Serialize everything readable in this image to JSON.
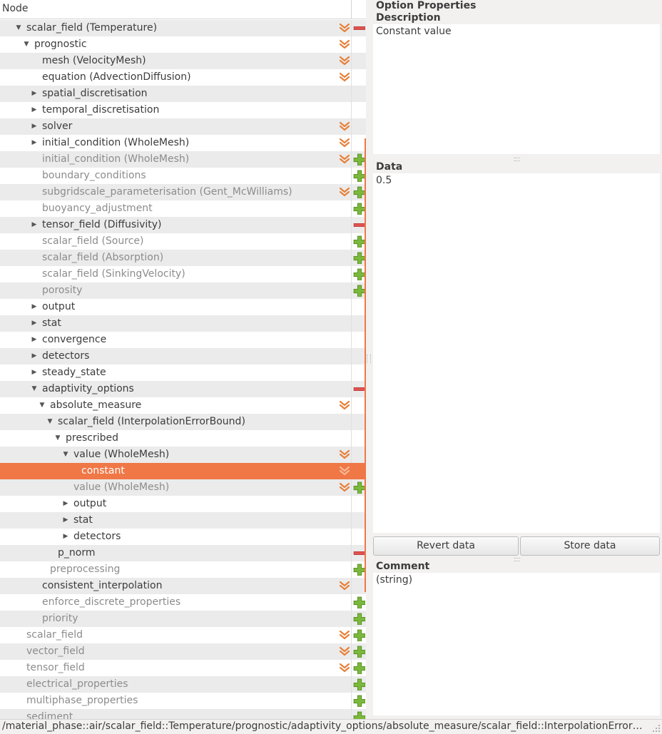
{
  "tree": {
    "header_label": "Node",
    "rows": [
      {
        "label": "scalar_field (Temperature)",
        "level": 2,
        "expander": "expanded",
        "state": "active",
        "chevron": true,
        "action": "remove"
      },
      {
        "label": "prognostic",
        "level": 3,
        "expander": "expanded",
        "state": "active",
        "chevron": true,
        "action": null
      },
      {
        "label": "mesh (VelocityMesh)",
        "level": 4,
        "expander": null,
        "state": "active",
        "chevron": true,
        "action": null
      },
      {
        "label": "equation (AdvectionDiffusion)",
        "level": 4,
        "expander": null,
        "state": "active",
        "chevron": true,
        "action": null
      },
      {
        "label": "spatial_discretisation",
        "level": 4,
        "expander": "collapsed",
        "state": "active",
        "chevron": false,
        "action": null
      },
      {
        "label": "temporal_discretisation",
        "level": 4,
        "expander": "collapsed",
        "state": "active",
        "chevron": false,
        "action": null
      },
      {
        "label": "solver",
        "level": 4,
        "expander": "collapsed",
        "state": "active",
        "chevron": true,
        "action": null
      },
      {
        "label": "initial_condition (WholeMesh)",
        "level": 4,
        "expander": "collapsed",
        "state": "active",
        "chevron": true,
        "action": null
      },
      {
        "label": "initial_condition (WholeMesh)",
        "level": 4,
        "expander": null,
        "state": "inactive",
        "chevron": true,
        "action": "add"
      },
      {
        "label": "boundary_conditions",
        "level": 4,
        "expander": null,
        "state": "inactive",
        "chevron": false,
        "action": "add"
      },
      {
        "label": "subgridscale_parameterisation (Gent_McWilliams)",
        "level": 4,
        "expander": null,
        "state": "inactive",
        "chevron": true,
        "action": "add"
      },
      {
        "label": "buoyancy_adjustment",
        "level": 4,
        "expander": null,
        "state": "inactive",
        "chevron": false,
        "action": "add"
      },
      {
        "label": "tensor_field (Diffusivity)",
        "level": 4,
        "expander": "collapsed",
        "state": "active",
        "chevron": false,
        "action": "remove"
      },
      {
        "label": "scalar_field (Source)",
        "level": 4,
        "expander": null,
        "state": "inactive",
        "chevron": false,
        "action": "add"
      },
      {
        "label": "scalar_field (Absorption)",
        "level": 4,
        "expander": null,
        "state": "inactive",
        "chevron": false,
        "action": "add"
      },
      {
        "label": "scalar_field (SinkingVelocity)",
        "level": 4,
        "expander": null,
        "state": "inactive",
        "chevron": false,
        "action": "add"
      },
      {
        "label": "porosity",
        "level": 4,
        "expander": null,
        "state": "inactive",
        "chevron": false,
        "action": "add"
      },
      {
        "label": "output",
        "level": 4,
        "expander": "collapsed",
        "state": "active",
        "chevron": false,
        "action": null
      },
      {
        "label": "stat",
        "level": 4,
        "expander": "collapsed",
        "state": "active",
        "chevron": false,
        "action": null
      },
      {
        "label": "convergence",
        "level": 4,
        "expander": "collapsed",
        "state": "active",
        "chevron": false,
        "action": null
      },
      {
        "label": "detectors",
        "level": 4,
        "expander": "collapsed",
        "state": "active",
        "chevron": false,
        "action": null
      },
      {
        "label": "steady_state",
        "level": 4,
        "expander": "collapsed",
        "state": "active",
        "chevron": false,
        "action": null
      },
      {
        "label": "adaptivity_options",
        "level": 4,
        "expander": "expanded",
        "state": "active",
        "chevron": false,
        "action": "remove"
      },
      {
        "label": "absolute_measure",
        "level": 5,
        "expander": "expanded",
        "state": "active",
        "chevron": true,
        "action": null
      },
      {
        "label": "scalar_field (InterpolationErrorBound)",
        "level": 6,
        "expander": "expanded",
        "state": "active",
        "chevron": false,
        "action": null
      },
      {
        "label": "prescribed",
        "level": 7,
        "expander": "expanded",
        "state": "active",
        "chevron": false,
        "action": null
      },
      {
        "label": "value (WholeMesh)",
        "level": 8,
        "expander": "expanded",
        "state": "active",
        "chevron": true,
        "action": null
      },
      {
        "label": "constant",
        "level": 9,
        "expander": null,
        "state": "selected",
        "chevron": true,
        "action": null
      },
      {
        "label": "value (WholeMesh)",
        "level": 8,
        "expander": null,
        "state": "inactive",
        "chevron": true,
        "action": "add"
      },
      {
        "label": "output",
        "level": 8,
        "expander": "collapsed",
        "state": "active",
        "chevron": false,
        "action": null
      },
      {
        "label": "stat",
        "level": 8,
        "expander": "collapsed",
        "state": "active",
        "chevron": false,
        "action": null
      },
      {
        "label": "detectors",
        "level": 8,
        "expander": "collapsed",
        "state": "active",
        "chevron": false,
        "action": null
      },
      {
        "label": "p_norm",
        "level": 6,
        "expander": null,
        "state": "active",
        "chevron": false,
        "action": "remove"
      },
      {
        "label": "preprocessing",
        "level": 5,
        "expander": null,
        "state": "inactive",
        "chevron": false,
        "action": "add"
      },
      {
        "label": "consistent_interpolation",
        "level": 4,
        "expander": null,
        "state": "active",
        "chevron": true,
        "action": null
      },
      {
        "label": "enforce_discrete_properties",
        "level": 4,
        "expander": null,
        "state": "inactive",
        "chevron": false,
        "action": "add"
      },
      {
        "label": "priority",
        "level": 4,
        "expander": null,
        "state": "inactive",
        "chevron": false,
        "action": "add"
      },
      {
        "label": "scalar_field",
        "level": 2,
        "expander": null,
        "state": "inactive",
        "chevron": true,
        "action": "add"
      },
      {
        "label": "vector_field",
        "level": 2,
        "expander": null,
        "state": "inactive",
        "chevron": true,
        "action": "add"
      },
      {
        "label": "tensor_field",
        "level": 2,
        "expander": null,
        "state": "inactive",
        "chevron": true,
        "action": "add"
      },
      {
        "label": "electrical_properties",
        "level": 2,
        "expander": null,
        "state": "inactive",
        "chevron": false,
        "action": "add"
      },
      {
        "label": "multiphase_properties",
        "level": 2,
        "expander": null,
        "state": "inactive",
        "chevron": false,
        "action": "add"
      },
      {
        "label": "sediment",
        "level": 2,
        "expander": null,
        "state": "inactive",
        "chevron": false,
        "action": "add"
      }
    ]
  },
  "properties": {
    "title": "Option Properties",
    "description_label": "Description",
    "description_text": "Constant value",
    "data_label": "Data",
    "data_value": "0.5",
    "revert_button": "Revert data",
    "store_button": "Store data",
    "comment_label": "Comment",
    "comment_text": "(string)"
  },
  "status_bar": {
    "path": "/material_phase::air/scalar_field::Temperature/prognostic/adaptivity_options/absolute_measure/scalar_field::InterpolationError…"
  },
  "colors": {
    "selection": "#f07746",
    "add_icon": "#7cb83c",
    "remove_icon": "#e05252",
    "chevron": "#e8803a"
  }
}
